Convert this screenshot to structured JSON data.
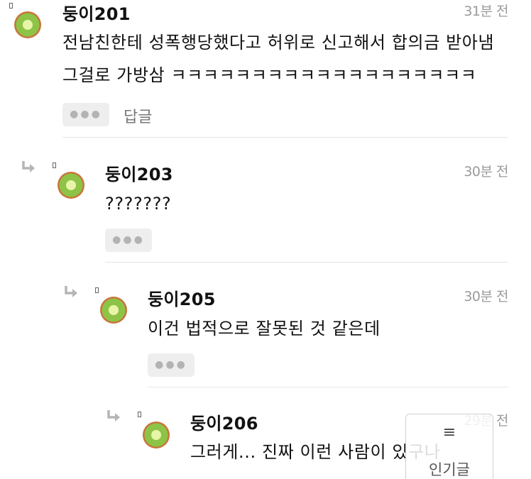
{
  "comments": [
    {
      "user": "둥이201",
      "time": "31분 전",
      "body": "전남친한테 성폭행당했다고 허위로 신고해서 합의금 받아냄 그걸로 가방삼 ㅋㅋㅋㅋㅋㅋㅋㅋㅋㅋㅋㅋㅋㅋㅋㅋㅋㅋㅋ",
      "more_label": "●●●",
      "reply_label": "답글"
    },
    {
      "user": "둥이203",
      "time": "30분 전",
      "body": "???????",
      "more_label": "●●●"
    },
    {
      "user": "둥이205",
      "time": "30분 전",
      "body": "이건 법적으로 잘못된 것 같은데",
      "more_label": "●●●"
    },
    {
      "user": "둥이206",
      "time": "29분 전",
      "body": "그러게... 진짜 이런 사람이 있구나"
    }
  ],
  "floating_button": {
    "icon": "menu-icon",
    "label": "인기글"
  },
  "colors": {
    "avatar_outer": "#c9743a",
    "avatar_green": "#8dc447",
    "avatar_core": "#e8f5a8"
  }
}
